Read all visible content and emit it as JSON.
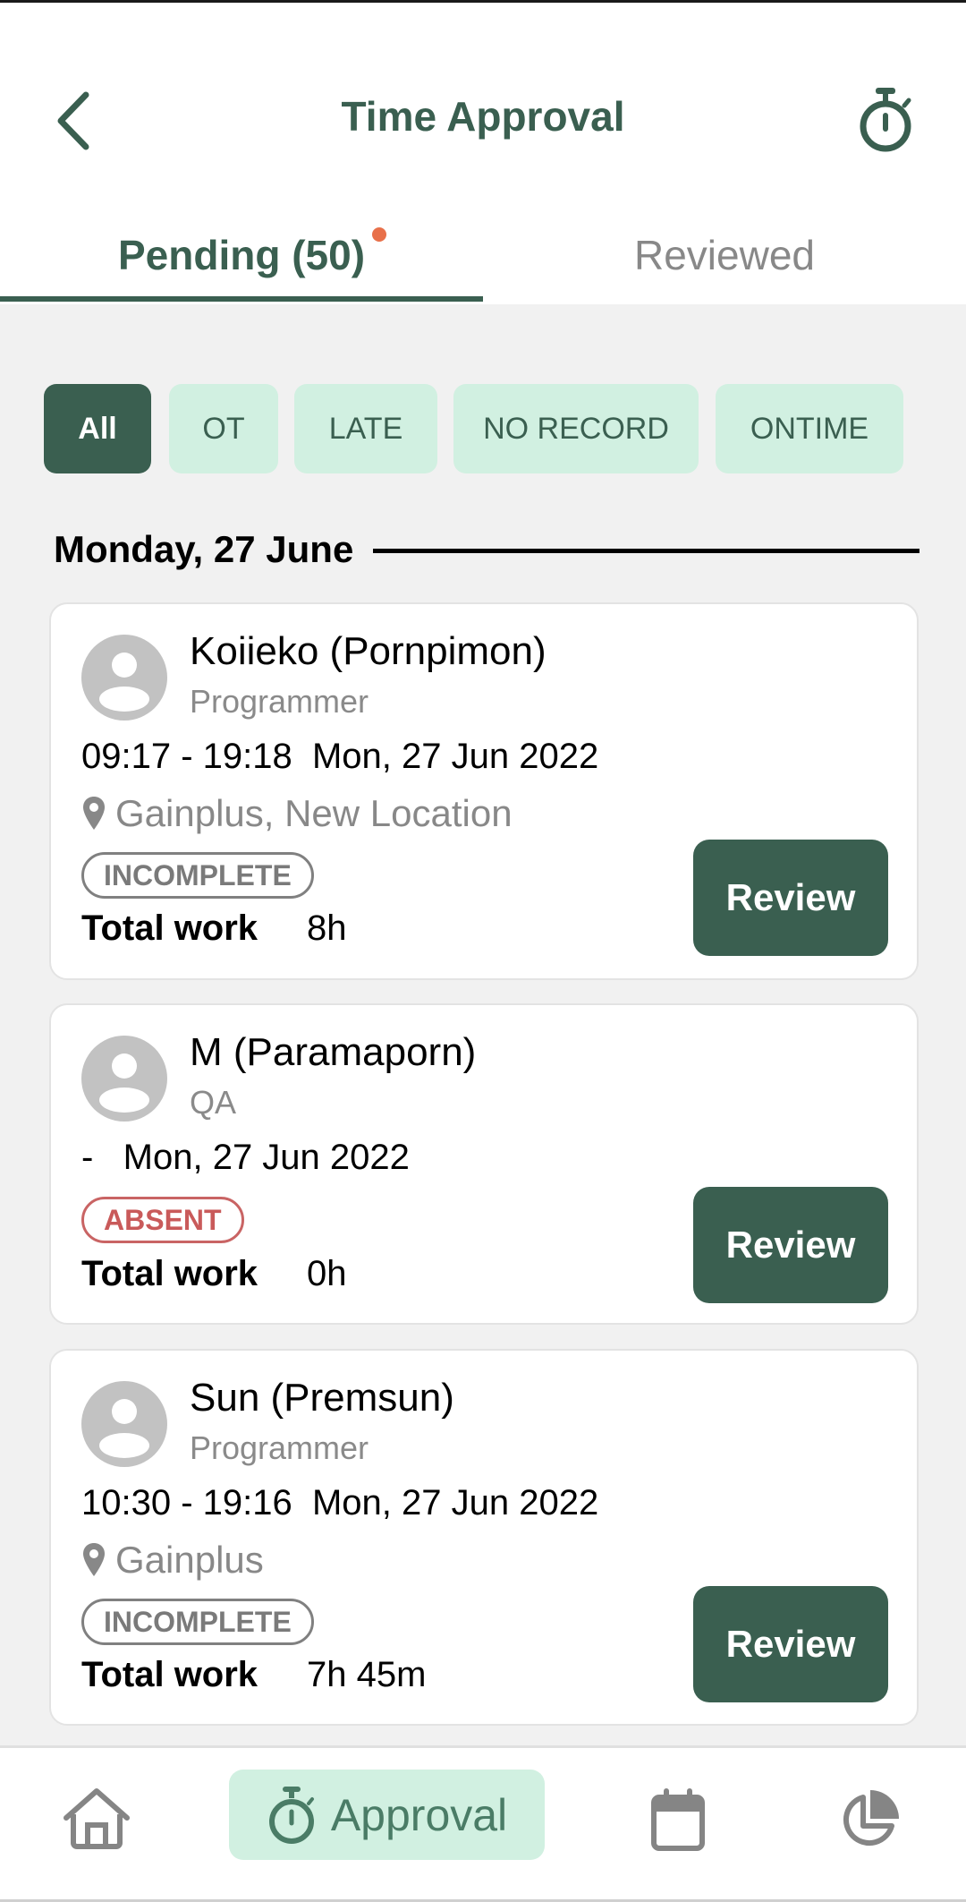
{
  "header": {
    "title": "Time Approval",
    "back_icon": "chevron-left-icon",
    "right_icon": "stopwatch-icon"
  },
  "tabs": [
    {
      "label": "Pending (50)",
      "active": true,
      "has_notification_dot": true
    },
    {
      "label": "Reviewed",
      "active": false
    }
  ],
  "filters": [
    {
      "label": "All",
      "selected": true
    },
    {
      "label": "OT",
      "selected": false
    },
    {
      "label": "LATE",
      "selected": false
    },
    {
      "label": "NO RECORD",
      "selected": false
    },
    {
      "label": "ONTIME",
      "selected": false
    }
  ],
  "date_group": "Monday, 27 June",
  "records": [
    {
      "name": "Koiieko (Pornpimon)",
      "role": "Programmer",
      "time": "09:17 - 19:18  Mon, 27 Jun 2022",
      "location": "Gainplus, New Location",
      "status": "INCOMPLETE",
      "total_label": "Total work",
      "total_value": "8h",
      "action": "Review"
    },
    {
      "name": "M (Paramaporn)",
      "role": "QA",
      "time": "-   Mon, 27 Jun 2022",
      "status": "ABSENT",
      "total_label": "Total work",
      "total_value": "0h",
      "action": "Review"
    },
    {
      "name": "Sun (Premsun)",
      "role": "Programmer",
      "time": "10:30 - 19:16  Mon, 27 Jun 2022",
      "location": "Gainplus",
      "status": "INCOMPLETE",
      "total_label": "Total work",
      "total_value": "7h 45m",
      "action": "Review"
    }
  ],
  "bottom_nav": [
    {
      "icon": "home-icon",
      "label": "",
      "active": false
    },
    {
      "icon": "stopwatch-icon",
      "label": "Approval",
      "active": true
    },
    {
      "icon": "calendar-icon",
      "label": "",
      "active": false
    },
    {
      "icon": "pie-chart-icon",
      "label": "",
      "active": false
    }
  ],
  "colors": {
    "primary": "#3a5f50",
    "chip_bg": "#d1f0e1",
    "notification_dot": "#e8704a",
    "absent": "#c95a5a",
    "muted": "#888888"
  }
}
